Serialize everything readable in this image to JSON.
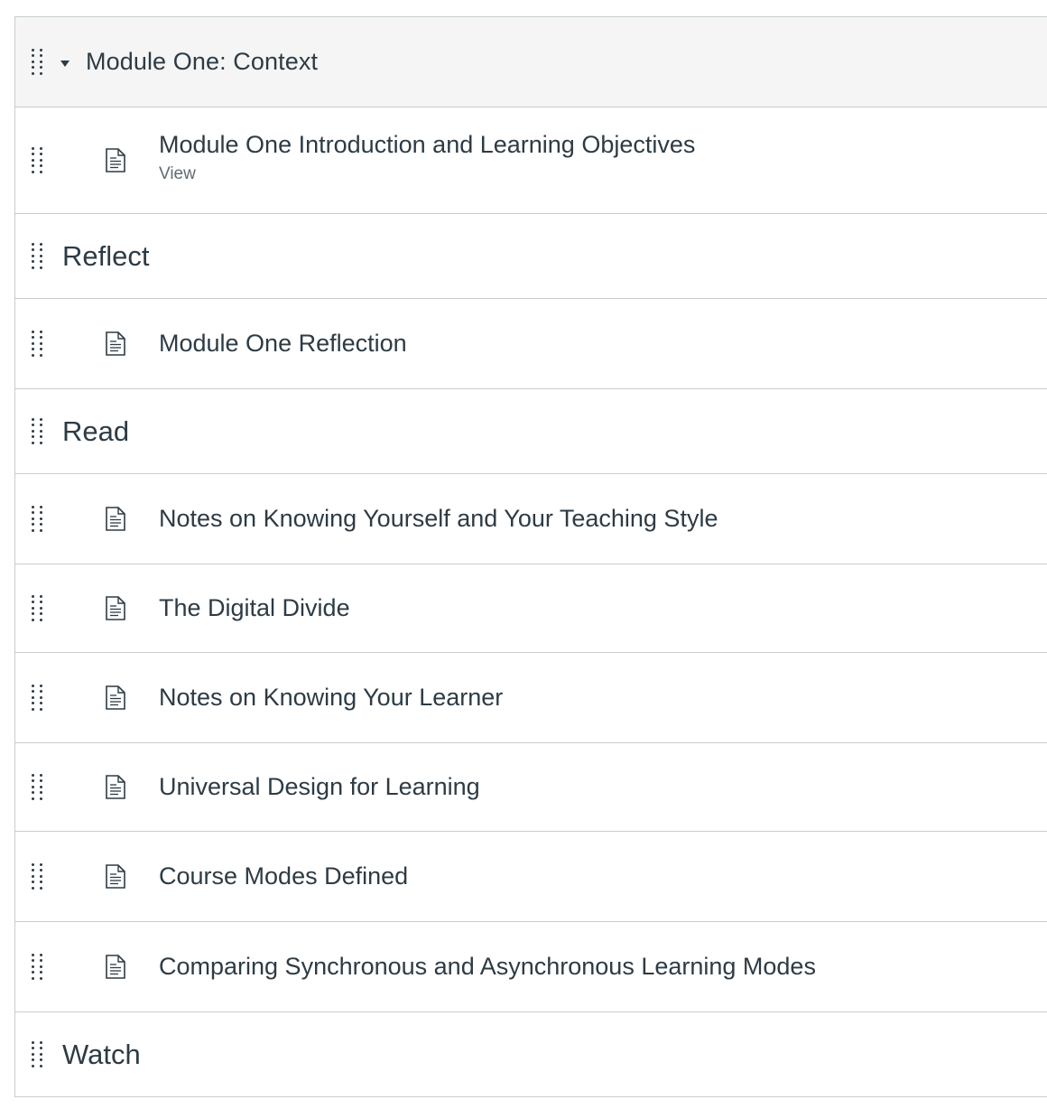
{
  "module": {
    "title": "Module One: Context",
    "rows": [
      {
        "kind": "item",
        "title": "Module One Introduction and Learning Objectives",
        "sub": "View"
      },
      {
        "kind": "header",
        "title": "Reflect"
      },
      {
        "kind": "item",
        "title": "Module One Reflection"
      },
      {
        "kind": "header",
        "title": "Read"
      },
      {
        "kind": "item",
        "title": "Notes on Knowing Yourself and Your Teaching Style"
      },
      {
        "kind": "item",
        "title": "The Digital Divide"
      },
      {
        "kind": "item",
        "title": "Notes on Knowing Your Learner"
      },
      {
        "kind": "item",
        "title": "Universal Design for Learning"
      },
      {
        "kind": "item",
        "title": "Course Modes Defined"
      },
      {
        "kind": "item",
        "title": "Comparing Synchronous and Asynchronous Learning Modes"
      },
      {
        "kind": "header",
        "title": "Watch"
      }
    ]
  },
  "icons": {
    "drag": "drag-handle-icon",
    "caret": "caret-down-icon",
    "document": "document-icon"
  }
}
